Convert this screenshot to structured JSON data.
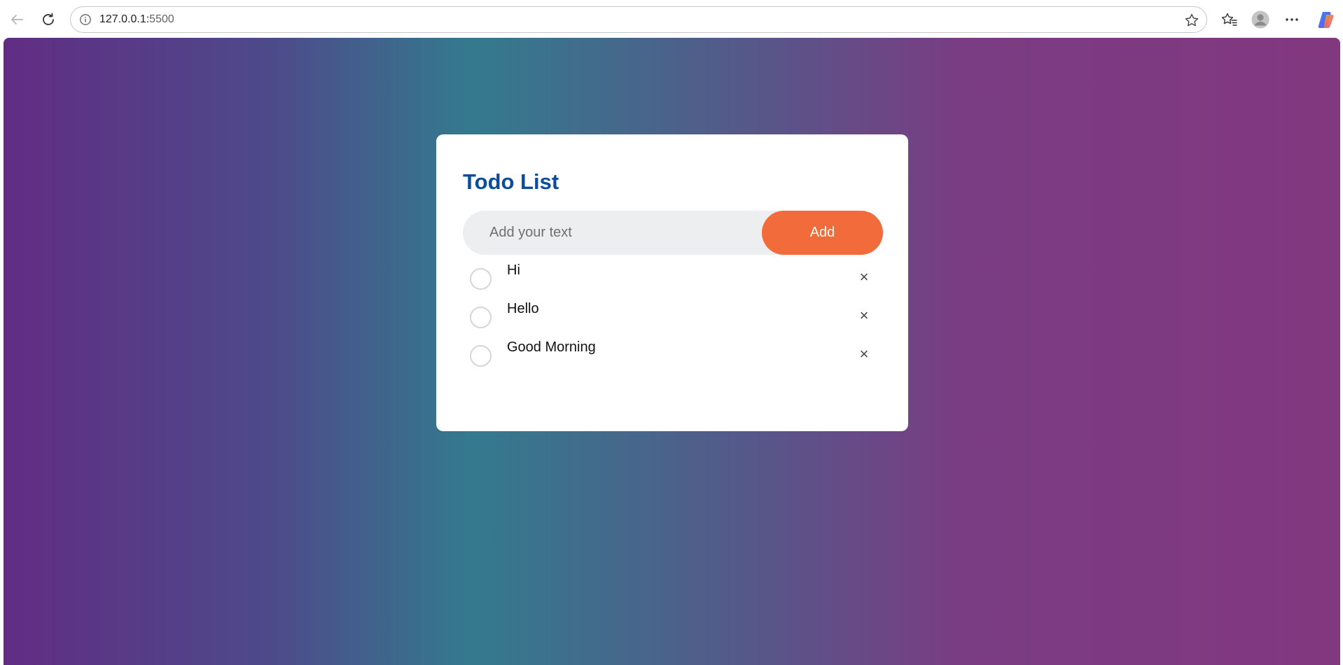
{
  "browser": {
    "url_host": "127.0.0.1:",
    "url_port": "5500"
  },
  "app": {
    "title": "Todo List",
    "input": {
      "placeholder": "Add your text",
      "value": ""
    },
    "add_label": "Add",
    "todos": [
      {
        "text": "Hi",
        "done": false
      },
      {
        "text": "Hello",
        "done": false
      },
      {
        "text": "Good Morning",
        "done": false
      }
    ],
    "remove_glyph": "×"
  },
  "colors": {
    "title": "#0c4c9e",
    "accent": "#f26b3a",
    "gradient": [
      "#612d84",
      "#347a8e",
      "#82387f"
    ]
  },
  "icons": [
    "back-icon",
    "reload-icon",
    "info-icon",
    "star-icon",
    "favorites-icon",
    "profile-icon",
    "more-icon",
    "copilot-icon"
  ]
}
